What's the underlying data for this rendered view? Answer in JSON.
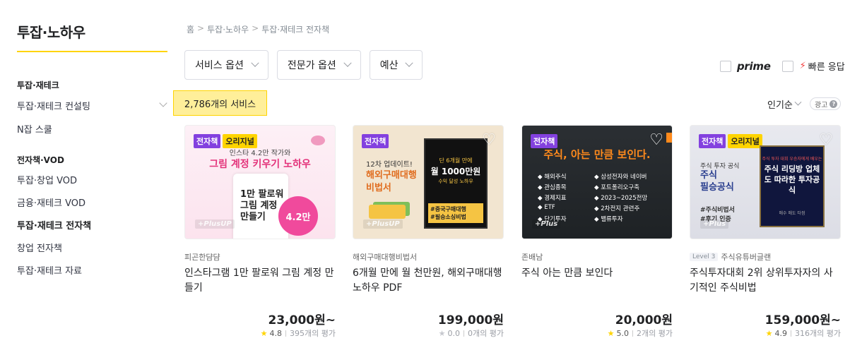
{
  "sidebar": {
    "title": "투잡·노하우",
    "sections": [
      {
        "heading": "투잡·재테크",
        "items": [
          {
            "label": "투잡·재테크 컨설팅",
            "active": false,
            "expandable": true
          },
          {
            "label": "N잡 스쿨",
            "active": false,
            "expandable": false
          }
        ]
      },
      {
        "heading": "전자책·VOD",
        "items": [
          {
            "label": "투잡·창업 VOD",
            "active": false
          },
          {
            "label": "금융·재테크 VOD",
            "active": false
          },
          {
            "label": "투잡·재테크 전자책",
            "active": true
          },
          {
            "label": "창업 전자책",
            "active": false
          },
          {
            "label": "투잡·재테크 자료",
            "active": false
          }
        ]
      }
    ]
  },
  "breadcrumb": [
    "홈",
    "투잡·노하우",
    "투잡·재테크 전자책"
  ],
  "breadcrumb_sep": ">",
  "filters": [
    "서비스 옵션",
    "전문가 옵션",
    "예산"
  ],
  "toggles": {
    "prime": "prime",
    "fast": "빠른 응답"
  },
  "service_count": "2,786개의 서비스",
  "sort": {
    "label": "인기순",
    "ad": "광고",
    "ad_help": "?"
  },
  "cards": [
    {
      "badges": [
        "전자책",
        "오리지널"
      ],
      "plus": "+PlusUP",
      "thumb": {
        "top": "인스타 4.2만 작가와",
        "head": "그림 계정 키우기 노하우",
        "book": "1만 팔로워 그림 계정 만들기",
        "circle": "4.2만"
      },
      "seller": "피곤한댬댬",
      "level": "",
      "title": "인스타그램 1만 팔로워 그림 계정 만들기",
      "price": "23,000원~",
      "rating": "4.8",
      "reviews": "395개의 평가",
      "rated": true
    },
    {
      "badges": [
        "전자책"
      ],
      "plus": "+PlusUP",
      "thumb": {
        "small": "12차 업데이트!",
        "big1": "해외구매대행",
        "big2": "비법서",
        "book1": "단 6개월 만에",
        "book2": "월 1000만원",
        "book3": "수익 달성 노하우",
        "tag1": "#중국구매대행",
        "tag2": "#필승소싱비법"
      },
      "seller": "해외구매대행비법서",
      "level": "",
      "title": "6개월 만에 월 천만원, 해외구매대행 노하우 PDF",
      "price": "199,000원",
      "rating": "0.0",
      "reviews": "0개의 평가",
      "rated": false
    },
    {
      "badges": [
        "전자책"
      ],
      "plus": "+Plus",
      "thumb": {
        "head": "주식, 아는 만큼 보인다.",
        "list": [
          "◆ 해외주식",
          "◆ 삼성전자와 네이버",
          "◆ 관심종목",
          "◆ 포트폴리오구축",
          "◆ 경제지표",
          "◆ 2023~2025전망",
          "◆ ETF",
          "◆ 2차전지 관련주",
          "◆ 단기투자",
          "◆ 밸류투자"
        ]
      },
      "seller": "존배남",
      "level": "",
      "title": "주식 아는 만큼 보인다",
      "price": "20,000원",
      "rating": "5.0",
      "reviews": "2개의 평가",
      "rated": true
    },
    {
      "badges": [
        "전자책",
        "오리지널"
      ],
      "plus": "+Plus",
      "thumb": {
        "small": "주식 투자 공식",
        "big1": "주식",
        "big2": "필승공식",
        "tag1": "#주식비법서",
        "tag2": "#후기 인증",
        "book1": "주식 투자 대회 우승자에게 배우는",
        "book2": "주식 리딩방 업체도 따라한 투자공식",
        "book3": "매수 매도 타점"
      },
      "seller": "주식유튜버글랜",
      "level": "Level 3",
      "title": "주식투자대회 2위 상위투자자의 사기적인 주식비법",
      "price": "159,000원~",
      "rating": "4.9",
      "reviews": "316개의 평가",
      "rated": true
    }
  ],
  "colors": {
    "accent": "#ffd400",
    "ebook_badge": "#8341df",
    "original_badge": "#ffd400",
    "fast_bolt": "#f23d3d"
  }
}
